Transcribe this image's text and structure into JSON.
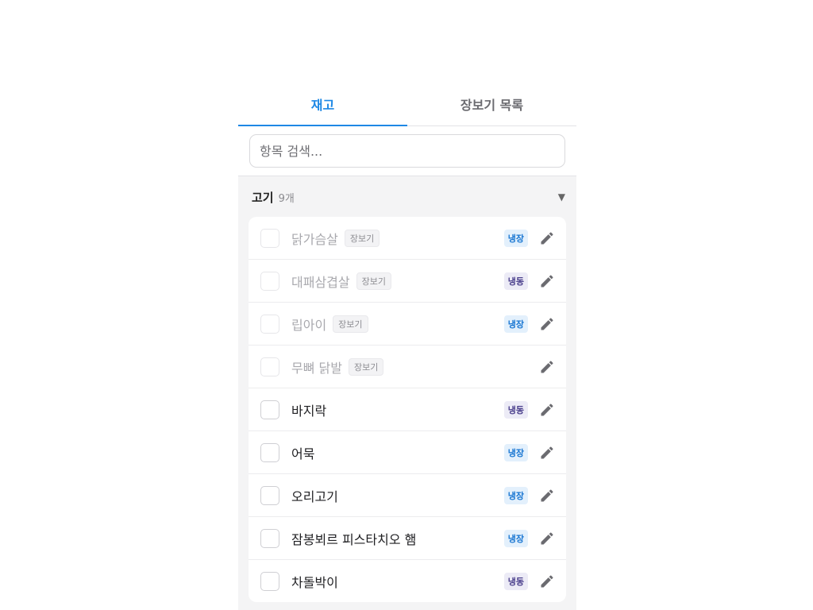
{
  "tabs": [
    {
      "label": "재고",
      "active": true
    },
    {
      "label": "장보기 목록",
      "active": false
    }
  ],
  "search": {
    "placeholder": "항목 검색...",
    "value": ""
  },
  "category": {
    "name": "고기",
    "count": "9개",
    "toggle": "▼"
  },
  "items": [
    {
      "name": "닭가슴살",
      "done": true,
      "shop_tag": "장보기",
      "storage": "냉장",
      "storage_type": "fridge"
    },
    {
      "name": "대패삼겹살",
      "done": true,
      "shop_tag": "장보기",
      "storage": "냉동",
      "storage_type": "freezer"
    },
    {
      "name": "립아이",
      "done": true,
      "shop_tag": "장보기",
      "storage": "냉장",
      "storage_type": "fridge"
    },
    {
      "name": "무뼈 닭발",
      "done": true,
      "shop_tag": "장보기",
      "storage": "",
      "storage_type": ""
    },
    {
      "name": "바지락",
      "done": false,
      "shop_tag": "",
      "storage": "냉동",
      "storage_type": "freezer"
    },
    {
      "name": "어묵",
      "done": false,
      "shop_tag": "",
      "storage": "냉장",
      "storage_type": "fridge"
    },
    {
      "name": "오리고기",
      "done": false,
      "shop_tag": "",
      "storage": "냉장",
      "storage_type": "fridge"
    },
    {
      "name": "잠봉뵈르 피스타치오 햄",
      "done": false,
      "shop_tag": "",
      "storage": "냉장",
      "storage_type": "fridge"
    },
    {
      "name": "차돌박이",
      "done": false,
      "shop_tag": "",
      "storage": "냉동",
      "storage_type": "freezer"
    }
  ],
  "colors": {
    "accent": "#1e88e5",
    "fridge_badge_bg": "#e3f0fc",
    "fridge_badge_text": "#1976d2",
    "freezer_badge_bg": "#ecebf6",
    "freezer_badge_text": "#4a3f8c"
  },
  "icons": {
    "edit": "pencil-icon",
    "toggle": "triangle-down-icon"
  }
}
